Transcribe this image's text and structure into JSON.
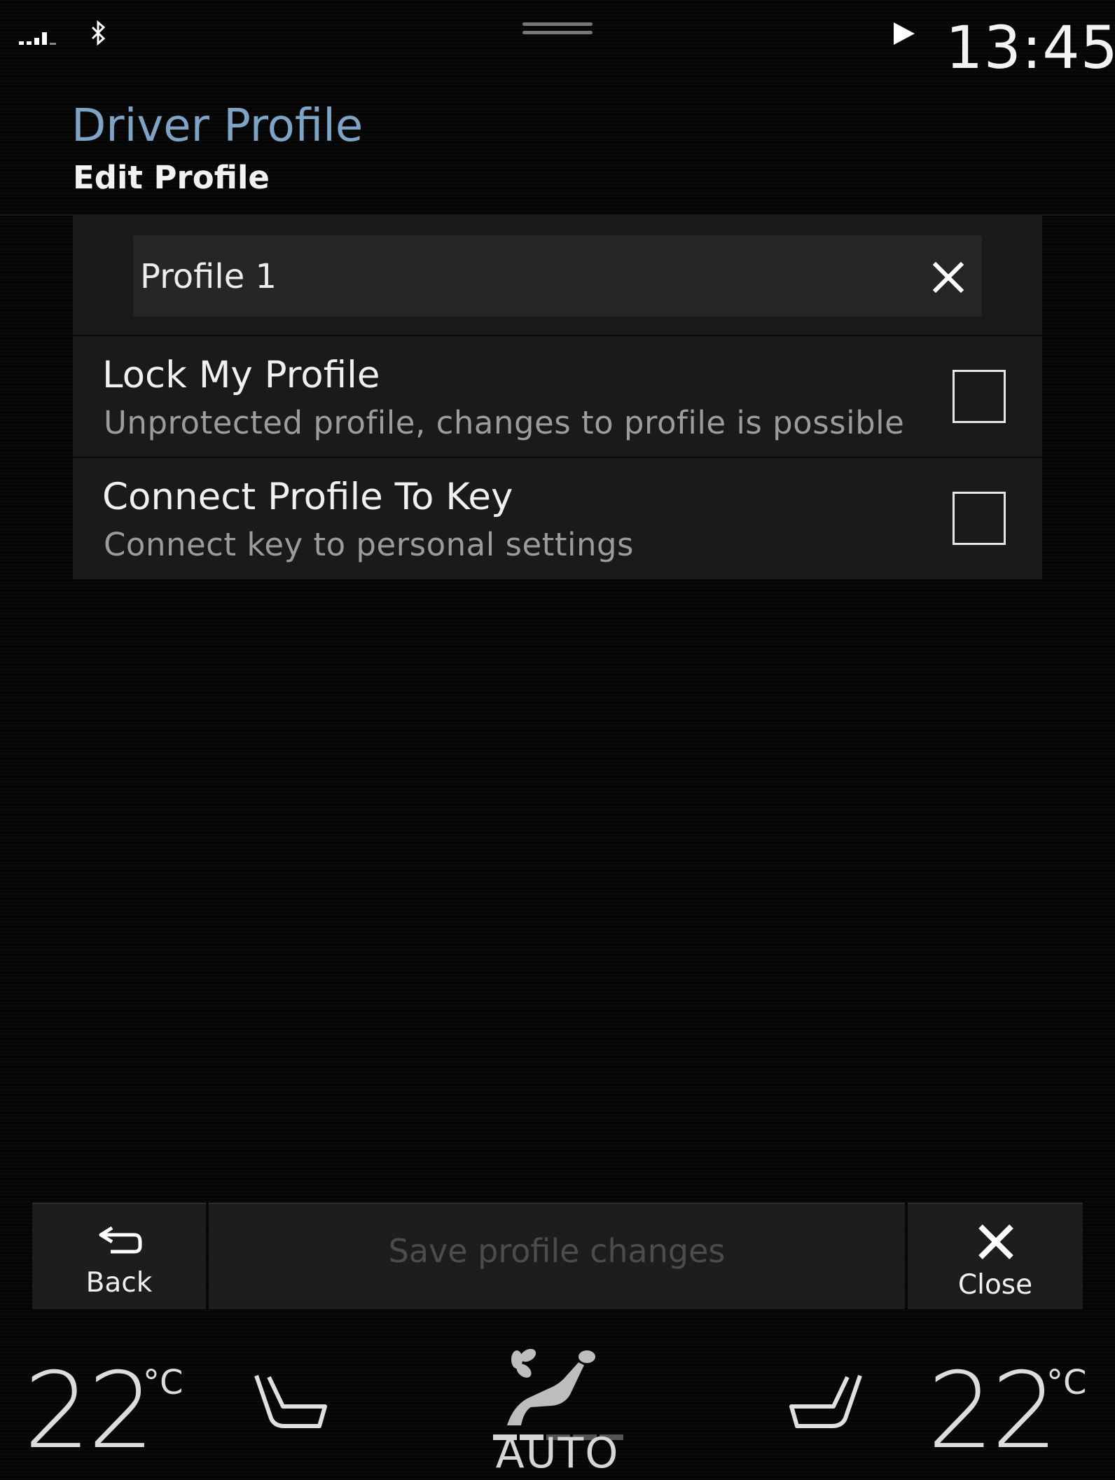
{
  "status_bar": {
    "signal_icon": "signal-strength-icon",
    "bluetooth_icon": "bluetooth-icon",
    "handle_icon": "drag-handle-icon",
    "play_icon": "play-icon",
    "time": "13:45"
  },
  "header": {
    "title": "Driver Profile",
    "subtitle": "Edit Profile",
    "title_color": "#7fa3c4"
  },
  "profile_name": {
    "value": "Profile 1",
    "clear_icon": "close-icon"
  },
  "options": [
    {
      "title": "Lock My Profile",
      "description": "Unprotected profile, changes to profile is possible",
      "checked": false
    },
    {
      "title": "Connect Profile To Key",
      "description": "Connect key to personal settings",
      "checked": false
    }
  ],
  "action_bar": {
    "back_label": "Back",
    "back_icon": "back-arrow-icon",
    "save_label": "Save profile changes",
    "save_enabled": false,
    "close_label": "Close",
    "close_icon": "close-icon"
  },
  "climate": {
    "left_temp": "22",
    "left_unit": "°C",
    "right_temp": "22",
    "right_unit": "°C",
    "left_seat_icon": "seat-heating-left-icon",
    "right_seat_icon": "seat-heating-right-icon",
    "fan_icon": "fan-airflow-icon",
    "fan_label": "AUTO"
  }
}
